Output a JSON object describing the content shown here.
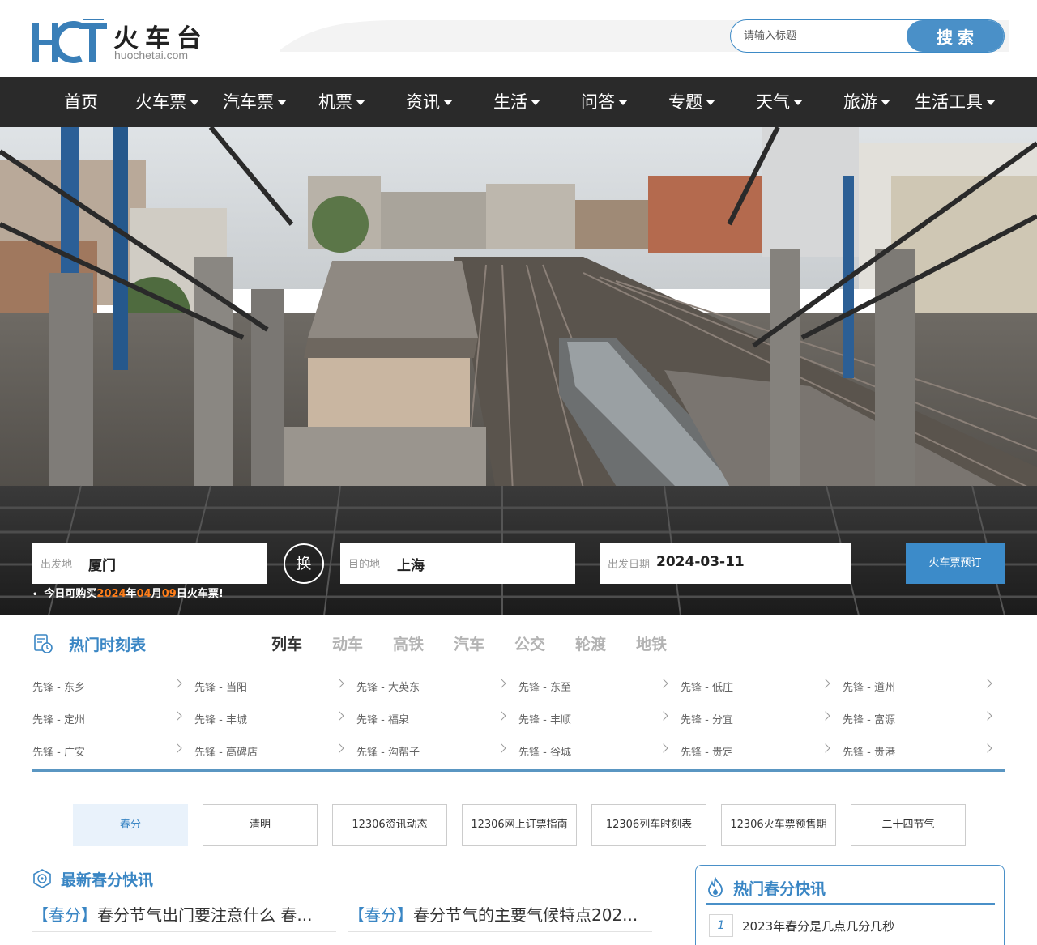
{
  "brand": {
    "logo_letters": "HCT",
    "name_cn": "火车台",
    "domain": "huochetai.com"
  },
  "search": {
    "placeholder": "请输入标题",
    "button_label": "搜索"
  },
  "nav": {
    "items": [
      {
        "label": "首页",
        "dropdown": false
      },
      {
        "label": "火车票",
        "dropdown": true
      },
      {
        "label": "汽车票",
        "dropdown": true
      },
      {
        "label": "机票",
        "dropdown": true
      },
      {
        "label": "资讯",
        "dropdown": true
      },
      {
        "label": "生活",
        "dropdown": true
      },
      {
        "label": "问答",
        "dropdown": true
      },
      {
        "label": "专题",
        "dropdown": true
      },
      {
        "label": "天气",
        "dropdown": true
      },
      {
        "label": "旅游",
        "dropdown": true
      },
      {
        "label": "生活工具",
        "dropdown": true
      }
    ]
  },
  "booking": {
    "from_label": "出发地",
    "from_value": "厦门",
    "swap_label": "换",
    "to_label": "目的地",
    "to_value": "上海",
    "date_label": "出发日期",
    "date_value": "2024-03-11",
    "submit_label": "火车票预订",
    "notice_prefix": "今日可购买",
    "notice_year": "2024",
    "notice_year_unit": "年",
    "notice_month": "04",
    "notice_month_unit": "月",
    "notice_day": "09",
    "notice_suffix": "日火车票!"
  },
  "timetable": {
    "title": "热门时刻表",
    "tabs": [
      "列车",
      "动车",
      "高铁",
      "汽车",
      "公交",
      "轮渡",
      "地铁"
    ],
    "routes": [
      [
        "先锋 - 东乡",
        "先锋 - 当阳",
        "先锋 - 大英东",
        "先锋 - 东至",
        "先锋 - 低庄",
        "先锋 - 道州"
      ],
      [
        "先锋 - 定州",
        "先锋 - 丰城",
        "先锋 - 福泉",
        "先锋 - 丰顺",
        "先锋 - 分宜",
        "先锋 - 富源"
      ],
      [
        "先锋 - 广安",
        "先锋 - 高碑店",
        "先锋 - 沟帮子",
        "先锋 - 谷城",
        "先锋 - 贵定",
        "先锋 - 贵港"
      ]
    ]
  },
  "topics": [
    "春分",
    "清明",
    "12306资讯动态",
    "12306网上订票指南",
    "12306列车时刻表",
    "12306火车票预售期",
    "二十四节气"
  ],
  "news": {
    "title": "最新春分快讯",
    "items": [
      {
        "tag": "【春分】",
        "text": "春分节气出门要注意什么 春..."
      },
      {
        "tag": "【春分】",
        "text": "春分节气的主要气候特点202..."
      }
    ]
  },
  "hot_news": {
    "title": "热门春分快讯",
    "items": [
      {
        "rank": "1",
        "text": "2023年春分是几点几分几秒"
      }
    ]
  },
  "colors": {
    "accent": "#3a86c4",
    "nav_bg": "#2a2a2a",
    "highlight": "#ff7e1a"
  }
}
